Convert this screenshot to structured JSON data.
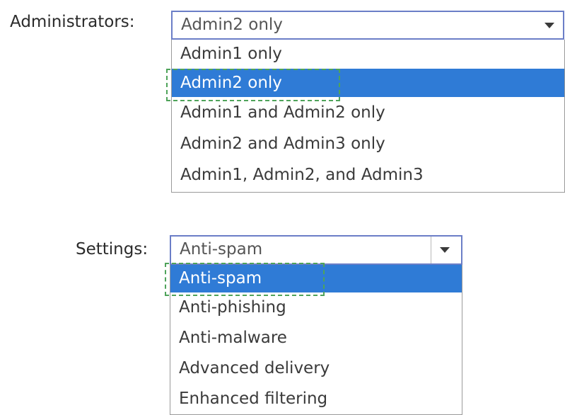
{
  "administrators": {
    "label": "Administrators:",
    "selected_value": "Admin2 only",
    "options": [
      "Admin1 only",
      "Admin2 only",
      "Admin1 and Admin2 only",
      "Admin2 and Admin3 only",
      "Admin1, Admin2, and Admin3"
    ],
    "highlighted_index": 1
  },
  "settings": {
    "label": "Settings:",
    "selected_value": "Anti-spam",
    "options": [
      "Anti-spam",
      "Anti-phishing",
      "Anti-malware",
      "Advanced delivery",
      "Enhanced filtering"
    ],
    "highlighted_index": 0
  },
  "colors": {
    "highlight": "#2f7bd6",
    "dashed_marker": "#4fa35a",
    "select_border": "#6b7ec7"
  },
  "icons": {
    "dropdown": "chevron-down-icon"
  }
}
